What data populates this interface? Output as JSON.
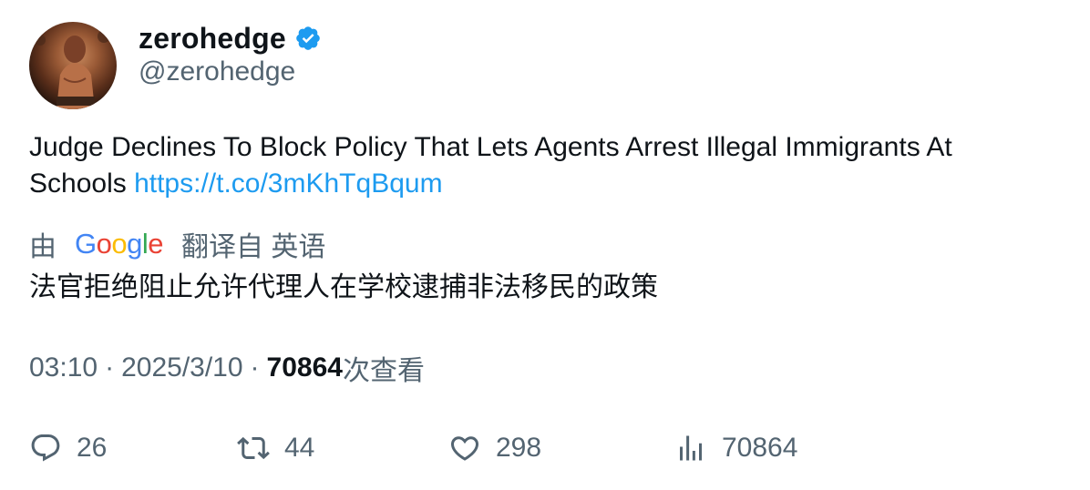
{
  "author": {
    "display_name": "zerohedge",
    "handle": "@zerohedge",
    "verified": true,
    "verified_color": "#1d9bf0"
  },
  "tweet": {
    "text": "Judge Declines To Block Policy That Lets Agents Arrest Illegal Immigrants At Schools",
    "link": "https://t.co/3mKhTqBqum",
    "link_color": "#1d9bf0"
  },
  "translation": {
    "prefix": "由",
    "provider": "Google",
    "suffix": "翻译自 英语",
    "text": "法官拒绝阻止允许代理人在学校逮捕非法移民的政策"
  },
  "meta": {
    "time": "03:10",
    "date": "2025/3/10",
    "views_count": "70864",
    "views_label": "次查看"
  },
  "actions": {
    "reply_count": "26",
    "retweet_count": "44",
    "like_count": "298",
    "views_count": "70864"
  },
  "icons": {
    "reply": "speech-bubble-icon",
    "retweet": "retweet-arrows-icon",
    "like": "heart-icon",
    "views": "bar-chart-icon",
    "verified": "verified-badge-icon"
  }
}
